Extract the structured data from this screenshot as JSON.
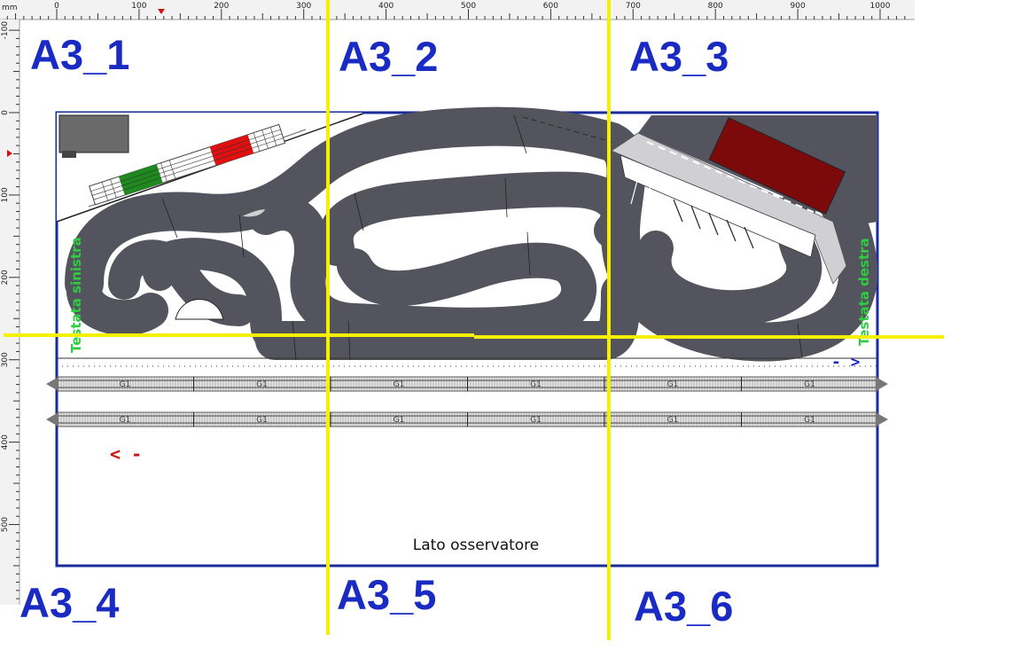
{
  "ruler": {
    "unit": "mm",
    "h_ticks": [
      "0",
      "100",
      "200",
      "300",
      "400",
      "500",
      "600",
      "700",
      "800",
      "900",
      "1000"
    ],
    "v_ticks": [
      "-100",
      "0",
      "100",
      "200",
      "300",
      "400",
      "500"
    ]
  },
  "panels": [
    "A3_1",
    "A3_2",
    "A3_3",
    "A3_4",
    "A3_5",
    "A3_6"
  ],
  "labels": {
    "left_end": "Testata sinistra",
    "right_end": "Testata destra",
    "observer_side": "Lato osservatore",
    "arrow_right": "- >",
    "arrow_left": "< -"
  },
  "rail_track_label": "G1",
  "colors": {
    "panel_text": "#1a2bc4",
    "cut_lines": "#f5f000",
    "road": "#54545e",
    "board_border": "#1a2b9c",
    "side_labels": "#2ecc40",
    "arrow_left": "#d01010",
    "building_red": "#7d0a0a"
  }
}
